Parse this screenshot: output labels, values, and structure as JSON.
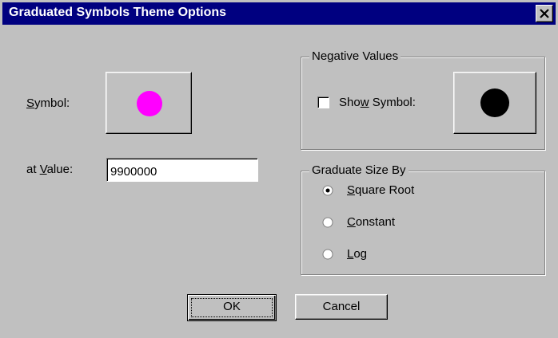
{
  "window": {
    "title": "Graduated Symbols Theme Options",
    "close_icon": "close-icon"
  },
  "symbol": {
    "label_prefix": "",
    "label_mnemonic": "S",
    "label_rest": "ymbol:",
    "color": "#ff00ff"
  },
  "at_value": {
    "label_prefix": "at ",
    "label_mnemonic": "V",
    "label_rest": "alue:",
    "value": "9900000"
  },
  "negative_values": {
    "group_label": "Negative Values",
    "show_symbol_prefix": "Sho",
    "show_symbol_mnemonic": "w",
    "show_symbol_rest": " Symbol:",
    "show_symbol_checked": false,
    "symbol_color": "#000000"
  },
  "graduate": {
    "group_label": "Graduate Size By",
    "options": [
      {
        "mnemonic": "S",
        "rest": "quare Root",
        "selected": true
      },
      {
        "mnemonic": "C",
        "rest": "onstant",
        "selected": false
      },
      {
        "mnemonic": "L",
        "rest": "og",
        "selected": false
      }
    ]
  },
  "buttons": {
    "ok": "OK",
    "cancel": "Cancel"
  }
}
